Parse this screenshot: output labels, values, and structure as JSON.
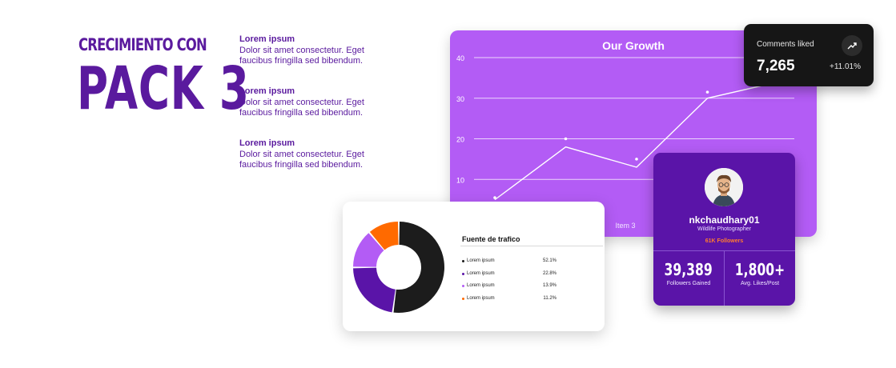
{
  "heading": {
    "small": "CRECIMIENTO CON",
    "big": "PACK 3"
  },
  "blocks": [
    {
      "title": "Lorem ipsum",
      "body": "Dolor sit amet consectetur. Eget faucibus fringilla sed bibendum."
    },
    {
      "title": "Lorem ipsum",
      "body": "Dolor sit amet consectetur. Eget faucibus fringilla sed bibendum."
    },
    {
      "title": "Lorem ipsum",
      "body": "Dolor sit amet consectetur. Eget faucibus fringilla sed bibendum."
    }
  ],
  "comments": {
    "label": "Comments liked",
    "value": "7,265",
    "change": "+11.01%",
    "icon": "trend-up-icon"
  },
  "traffic": {
    "title": "Fuente de trafico",
    "rows": [
      {
        "name": "Lorem ipsum",
        "pct": "52.1%",
        "color": "#1c1c1c"
      },
      {
        "name": "Lorem ipsum",
        "pct": "22.8%",
        "color": "#5a14a8"
      },
      {
        "name": "Lorem ipsum",
        "pct": "13.9%",
        "color": "#b35cf5"
      },
      {
        "name": "Lorem ipsum",
        "pct": "11.2%",
        "color": "#ff6a00"
      }
    ]
  },
  "profile": {
    "name": "nkchaudhary01",
    "role": "Wildlife Photographer",
    "followers": "61K Followers",
    "stats": [
      {
        "value": "39,389",
        "caption": "Followers Gained"
      },
      {
        "value": "1,800+",
        "caption": "Avg. Likes/Post"
      }
    ]
  },
  "chart_data": [
    {
      "type": "line",
      "title": "Our Growth",
      "categories": [
        "",
        "",
        "Item 3",
        "",
        ""
      ],
      "series": [
        {
          "values": [
            5,
            18,
            13,
            30,
            34
          ]
        }
      ],
      "points": [
        5.5,
        20,
        15,
        31.5
      ],
      "ylim": [
        0,
        40
      ],
      "yticks": [
        "40",
        "30",
        "20",
        "10"
      ],
      "grid": true,
      "color": "#ffffff"
    },
    {
      "type": "pie",
      "categories": [
        "Lorem ipsum",
        "Lorem ipsum",
        "Lorem ipsum",
        "Lorem ipsum"
      ],
      "values": [
        52.1,
        22.8,
        13.9,
        11.2
      ],
      "colors": [
        "#1c1c1c",
        "#5a14a8",
        "#b35cf5",
        "#ff6a00"
      ]
    }
  ],
  "colors": {
    "brand": "#5a1a9e",
    "chart_bg": "#b35cf5",
    "accent": "#ff6a00"
  }
}
